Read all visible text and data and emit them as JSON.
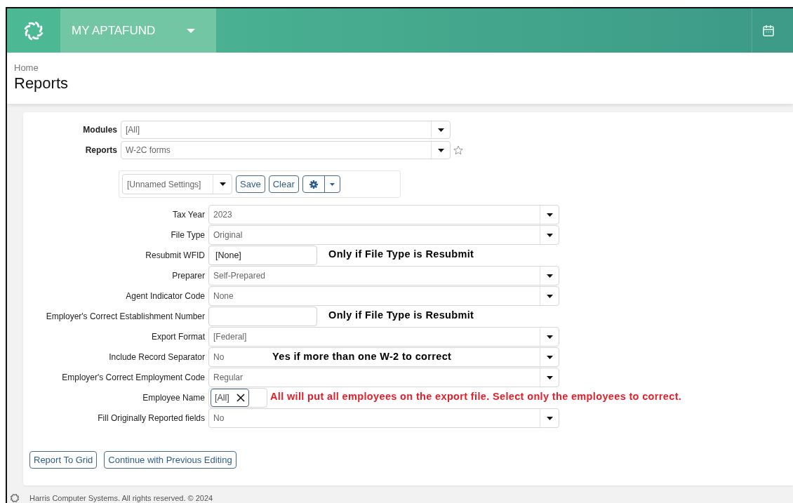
{
  "header": {
    "app_title": "MY APTAFUND"
  },
  "breadcrumb": {
    "home": "Home",
    "title": "Reports"
  },
  "selectors": [
    {
      "label": "Modules",
      "value": "[All]",
      "favorite": false
    },
    {
      "label": "Reports",
      "value": "W-2C forms",
      "favorite": true
    }
  ],
  "settings_toolbar": {
    "settings": "[Unnamed Settings]",
    "buttons": [
      "Save",
      "Clear"
    ]
  },
  "fields": [
    {
      "kind": "select",
      "label": "Tax Year",
      "value": "2023"
    },
    {
      "kind": "select",
      "label": "File Type",
      "value": "Original"
    },
    {
      "kind": "input",
      "label": "Resubmit WFID",
      "value": "[None]",
      "note": {
        "text": "Only if File Type is Resubmit",
        "color": "#000000"
      }
    },
    {
      "kind": "select",
      "label": "Preparer",
      "value": "Self-Prepared"
    },
    {
      "kind": "select",
      "label": "Agent Indicator Code",
      "value": "None"
    },
    {
      "kind": "input",
      "label": "Employer's Correct Establishment Number",
      "note": {
        "text": "Only if File Type is Resubmit",
        "color": "#000000"
      }
    },
    {
      "kind": "select",
      "label": "Export Format",
      "value": "[Federal]"
    },
    {
      "kind": "select",
      "label": "Include Record Separator",
      "value": "No",
      "note": {
        "text": "Yes if more than one W-2 to correct",
        "color": "#000000"
      }
    },
    {
      "kind": "select",
      "label": "Employer's Correct Employment Code",
      "value": "Regular"
    },
    {
      "kind": "tags",
      "label": "Employee Name",
      "value": "[All]",
      "note": {
        "text": "All will put all employees on the export file. Select only the employees to correct.",
        "color": "#e0202a"
      }
    },
    {
      "kind": "select",
      "label": "Fill Originally Reported fields",
      "value": "No"
    }
  ],
  "actions": [
    "Report To Grid",
    "Continue with Previous Editing"
  ],
  "footer": "Harris Computer Systems. All rights reserved. © 2024"
}
